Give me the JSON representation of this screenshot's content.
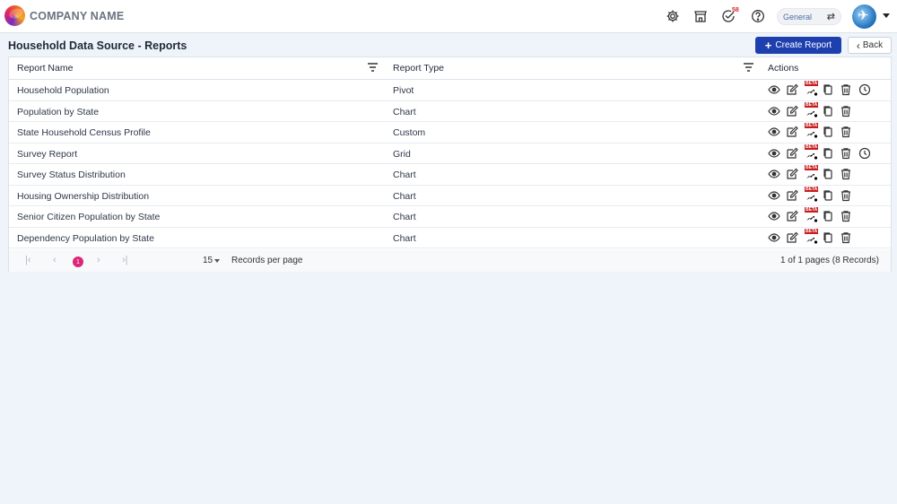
{
  "header": {
    "brand": "COMPANY NAME",
    "notification_count": "58",
    "workspace_label": "General",
    "icons": [
      "settings-icon",
      "store-icon",
      "tasks-check-icon",
      "help-icon",
      "swap-icon",
      "user-avatar"
    ]
  },
  "page": {
    "title": "Household Data Source - Reports",
    "create_label": "Create Report",
    "back_label": "Back"
  },
  "table": {
    "columns": [
      "Report Name",
      "Report Type",
      "Actions"
    ],
    "rows": [
      {
        "name": "Household Population",
        "type": "Pivot",
        "schedule": true
      },
      {
        "name": "Population by State",
        "type": "Chart",
        "schedule": false
      },
      {
        "name": "State Household Census Profile",
        "type": "Custom",
        "schedule": false
      },
      {
        "name": "Survey Report",
        "type": "Grid",
        "schedule": true
      },
      {
        "name": "Survey Status Distribution",
        "type": "Chart",
        "schedule": false
      },
      {
        "name": "Housing Ownership Distribution",
        "type": "Chart",
        "schedule": false
      },
      {
        "name": "Senior Citizen Population by State",
        "type": "Chart",
        "schedule": false
      },
      {
        "name": "Dependency Population by State",
        "type": "Chart",
        "schedule": false
      }
    ],
    "beta_label": "BETA",
    "action_icons": [
      "view-icon",
      "edit-icon",
      "beta-share-icon",
      "copy-icon",
      "delete-icon",
      "schedule-icon"
    ]
  },
  "pagination": {
    "current_page": "1",
    "page_size": "15",
    "per_page_label": "Records per page",
    "summary": "1 of 1 pages (8 Records)"
  },
  "colors": {
    "primary": "#1e40af",
    "active_page": "#db2777",
    "beta": "#c81e1e"
  }
}
